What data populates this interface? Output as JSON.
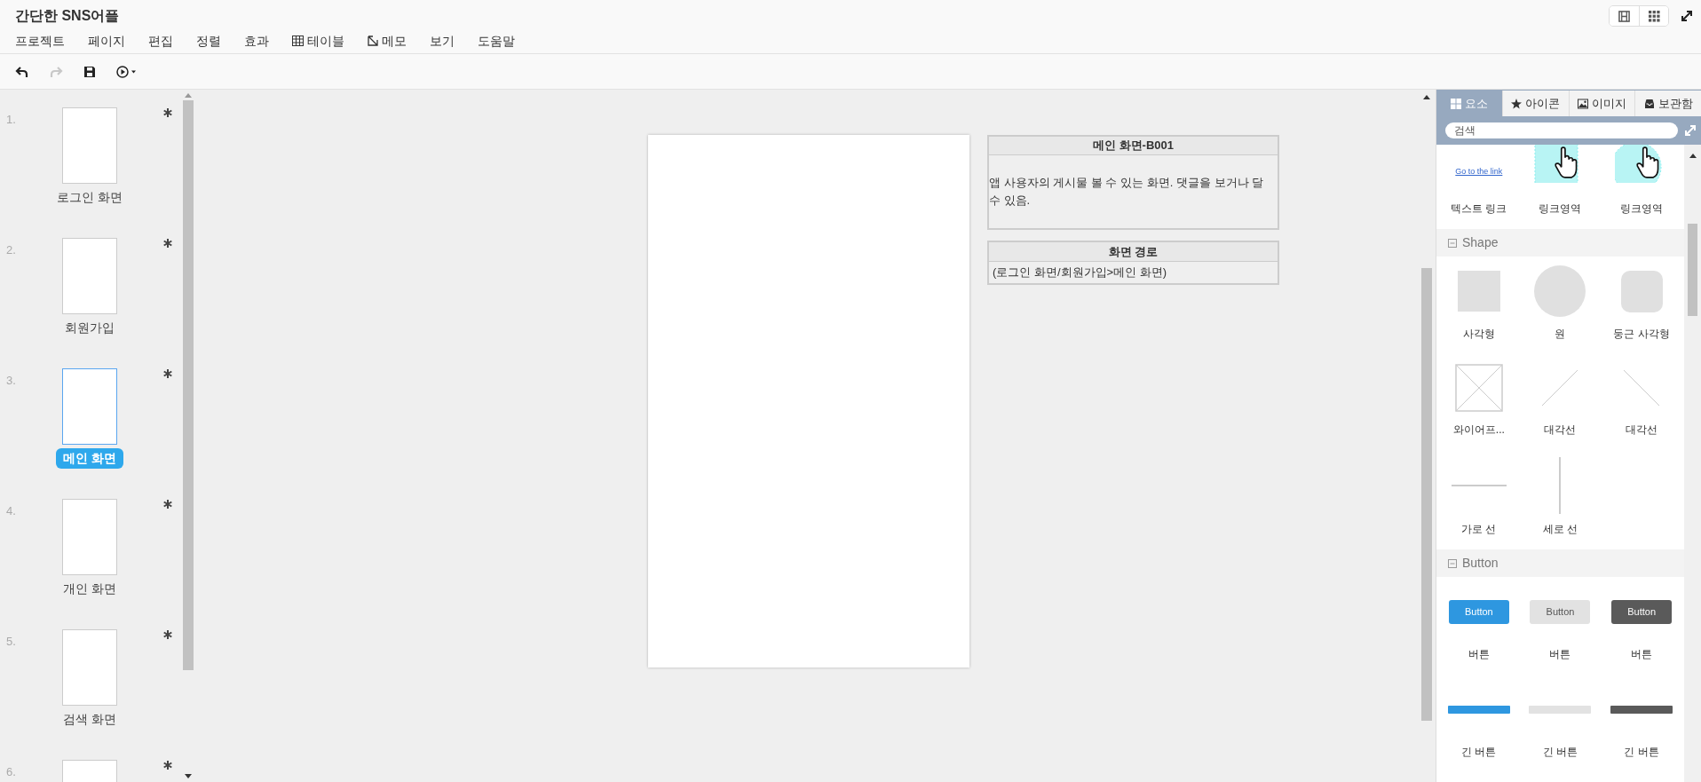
{
  "app": {
    "title": "간단한 SNS어플"
  },
  "menu": [
    {
      "label": "프로젝트",
      "kind": "plain"
    },
    {
      "label": "페이지",
      "kind": "plain"
    },
    {
      "label": "편집",
      "kind": "plain"
    },
    {
      "label": "정렬",
      "kind": "plain"
    },
    {
      "label": "효과",
      "kind": "plain"
    },
    {
      "label": "테이블",
      "kind": "table"
    },
    {
      "label": "메모",
      "kind": "memo"
    },
    {
      "label": "보기",
      "kind": "plain"
    },
    {
      "label": "도움말",
      "kind": "plain"
    }
  ],
  "toolbar": [
    {
      "kind": "undo",
      "disabled": false
    },
    {
      "kind": "redo",
      "disabled": true
    },
    {
      "kind": "save",
      "disabled": false
    },
    {
      "kind": "play",
      "disabled": false
    }
  ],
  "view_switch": [
    {
      "kind": "film",
      "selected": false
    },
    {
      "kind": "grid",
      "selected": false
    }
  ],
  "pages": [
    {
      "number": "1.",
      "label": "로그인 화면",
      "selected": false
    },
    {
      "number": "2.",
      "label": "회원가입",
      "selected": false
    },
    {
      "number": "3.",
      "label": "메인 화면",
      "selected": true
    },
    {
      "number": "4.",
      "label": "개인 화면",
      "selected": false
    },
    {
      "number": "5.",
      "label": "검색 화면",
      "selected": false
    },
    {
      "number": "6.",
      "selected": false
    }
  ],
  "description": {
    "title": "메인 화면-B001",
    "body": "앱 사용자의 게시물 볼 수 있는 화면. 댓글을 보거나 달 수 있음."
  },
  "path_box": {
    "title": "화면 경로",
    "body": "(로그인 화면/회원가입>메인 화면)"
  },
  "panel": {
    "tabs": [
      {
        "label": "요소",
        "kind": "grid",
        "selected": true
      },
      {
        "label": "아이콘",
        "kind": "star",
        "selected": false
      },
      {
        "label": "이미지",
        "kind": "image",
        "selected": false
      },
      {
        "label": "보관함",
        "kind": "inbox",
        "selected": false
      }
    ],
    "search": {
      "placeholder": "검색"
    },
    "sections": [
      {
        "items": [
          {
            "kind": "text_link",
            "preview": "Go to the link",
            "label": "텍스트 링크"
          },
          {
            "kind": "link_rect",
            "label": "링크영역"
          },
          {
            "kind": "link_circle",
            "label": "링크영역"
          }
        ]
      },
      {
        "title": "Shape",
        "expanded": true,
        "items": [
          {
            "kind": "rect",
            "label": "사각형"
          },
          {
            "kind": "circle",
            "label": "원"
          },
          {
            "kind": "rounded_rect",
            "label": "둥근 사각형"
          },
          {
            "kind": "wireframe",
            "label": "와이어프..."
          },
          {
            "kind": "diagonal_up",
            "label": "대각선"
          },
          {
            "kind": "diagonal_down",
            "label": "대각선"
          },
          {
            "kind": "hline",
            "label": "가로 선"
          },
          {
            "kind": "vline",
            "label": "세로 선"
          }
        ]
      },
      {
        "title": "Button",
        "expanded": true,
        "items": [
          {
            "kind": "button_primary",
            "preview": "Button",
            "label": "버튼"
          },
          {
            "kind": "button_light",
            "preview": "Button",
            "label": "버튼"
          },
          {
            "kind": "button_dark",
            "preview": "Button",
            "label": "버튼"
          },
          {
            "kind": "long_primary",
            "label": "긴 버튼"
          },
          {
            "kind": "long_light",
            "label": "긴 버튼"
          },
          {
            "kind": "long_dark",
            "label": "긴 버튼"
          }
        ]
      }
    ]
  }
}
